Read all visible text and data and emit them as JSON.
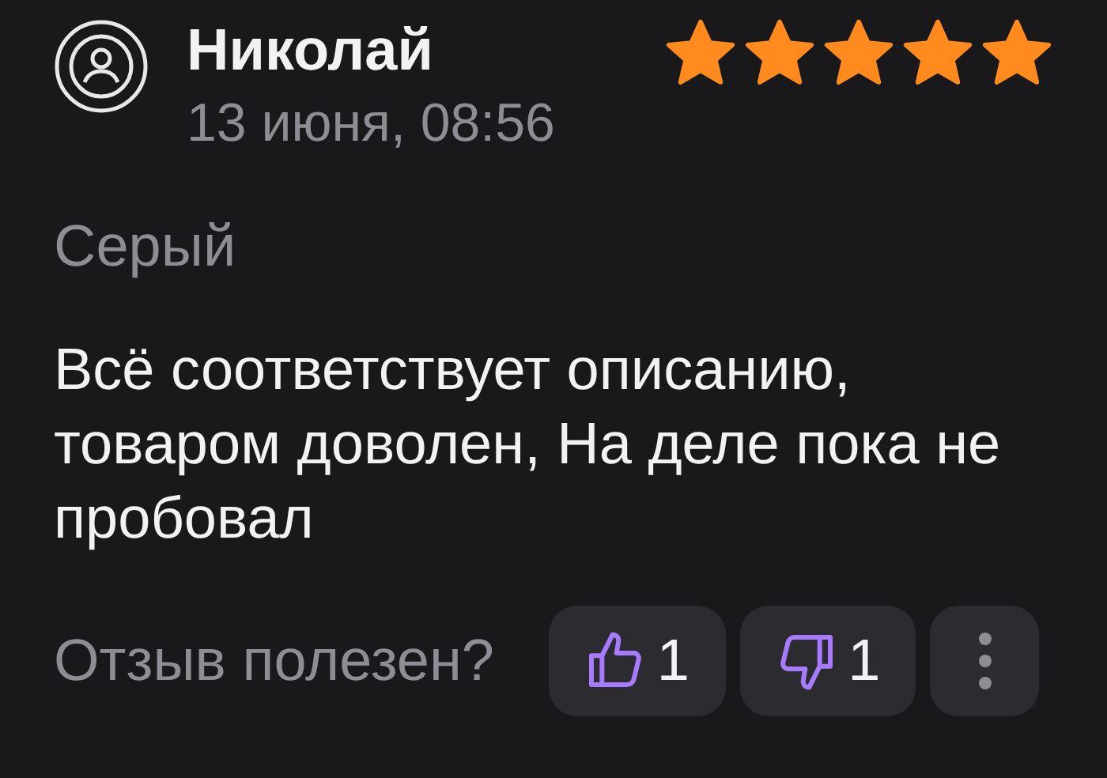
{
  "review": {
    "author": "Николай",
    "date": "13 июня, 08:56",
    "stars": 5,
    "variant": "Серый",
    "text": "Всё соответствует описанию, товаром доволен, На деле пока не пробовал"
  },
  "feedback": {
    "question": "Отзыв полезен?",
    "likes": "1",
    "dislikes": "1"
  }
}
